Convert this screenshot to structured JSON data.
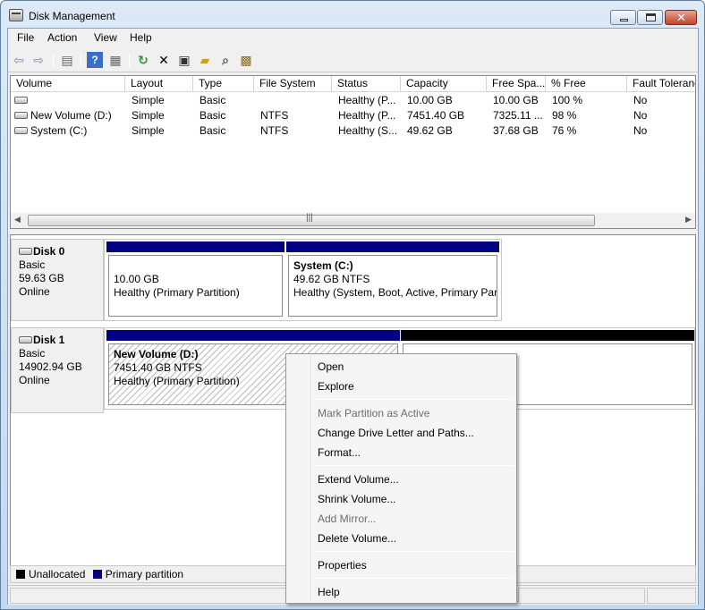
{
  "window": {
    "title": "Disk Management"
  },
  "menubar": [
    "File",
    "Action",
    "View",
    "Help"
  ],
  "toolbar": [
    {
      "name": "back-icon",
      "glyph": "⇦"
    },
    {
      "name": "forward-icon",
      "glyph": "⇨"
    },
    {
      "name": "console-tree-icon",
      "glyph": "▤"
    },
    {
      "name": "help-icon",
      "glyph": "?"
    },
    {
      "name": "action-pane-icon",
      "glyph": "▦"
    },
    {
      "name": "refresh-icon",
      "glyph": "↻"
    },
    {
      "name": "delete-icon",
      "glyph": "✕"
    },
    {
      "name": "properties-icon",
      "glyph": "▣"
    },
    {
      "name": "open-folder-icon",
      "glyph": "▰"
    },
    {
      "name": "search-icon",
      "glyph": "⌕"
    },
    {
      "name": "settings-icon",
      "glyph": "▩"
    }
  ],
  "volumes": {
    "columns": [
      "Volume",
      "Layout",
      "Type",
      "File System",
      "Status",
      "Capacity",
      "Free Spa...",
      "% Free",
      "Fault Toleranc"
    ],
    "rows": [
      [
        "",
        "Simple",
        "Basic",
        "",
        "Healthy (P...",
        "10.00 GB",
        "10.00 GB",
        "100 %",
        "No"
      ],
      [
        "New Volume (D:)",
        "Simple",
        "Basic",
        "NTFS",
        "Healthy (P...",
        "7451.40 GB",
        "7325.11 ...",
        "98 %",
        "No"
      ],
      [
        "System (C:)",
        "Simple",
        "Basic",
        "NTFS",
        "Healthy (S...",
        "49.62 GB",
        "37.68 GB",
        "76 %",
        "No"
      ]
    ]
  },
  "disks": [
    {
      "name": "Disk 0",
      "type": "Basic",
      "size": "59.63 GB",
      "status": "Online",
      "partitions": [
        {
          "title": "",
          "size": "10.00 GB",
          "status": "Healthy (Primary Partition)"
        },
        {
          "title": "System  (C:)",
          "size": "49.62 GB NTFS",
          "status": "Healthy (System, Boot, Active, Primary Par"
        }
      ]
    },
    {
      "name": "Disk 1",
      "type": "Basic",
      "size": "14902.94 GB",
      "status": "Online",
      "partitions": [
        {
          "title": "New Volume  (D:)",
          "size": "7451.40 GB NTFS",
          "status": "Healthy (Primary Partition)"
        }
      ]
    }
  ],
  "legend": [
    {
      "label": "Unallocated",
      "color": "#000000"
    },
    {
      "label": "Primary partition",
      "color": "#000080"
    }
  ],
  "context_menu": {
    "items": [
      {
        "label": "Open",
        "enabled": true
      },
      {
        "label": "Explore",
        "enabled": true
      },
      {
        "label": "Mark Partition as Active",
        "enabled": false
      },
      {
        "label": "Change Drive Letter and Paths...",
        "enabled": true
      },
      {
        "label": "Format...",
        "enabled": true
      },
      {
        "label": "Extend Volume...",
        "enabled": true
      },
      {
        "label": "Shrink Volume...",
        "enabled": true
      },
      {
        "label": "Add Mirror...",
        "enabled": false
      },
      {
        "label": "Delete Volume...",
        "enabled": true
      },
      {
        "label": "Properties",
        "enabled": true
      },
      {
        "label": "Help",
        "enabled": true
      }
    ]
  },
  "colors": {
    "primary_partition": "#000080",
    "unallocated": "#000000"
  }
}
